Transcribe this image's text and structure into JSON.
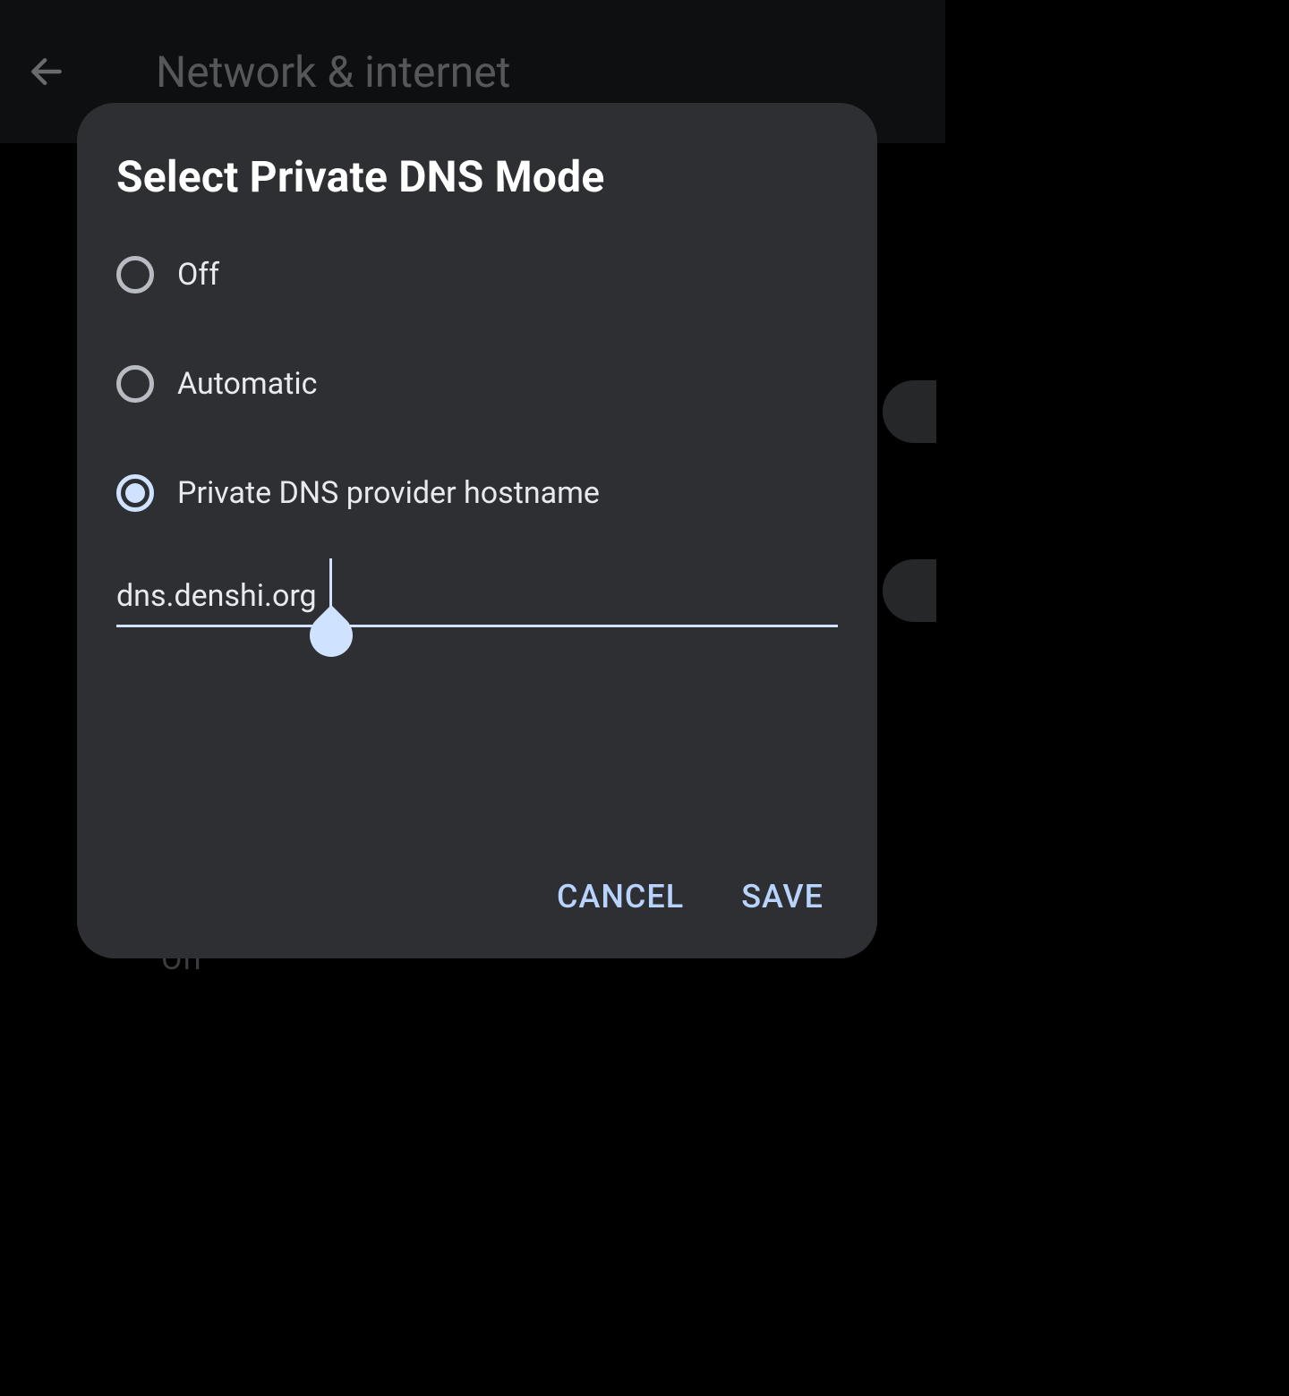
{
  "header": {
    "title": "Network & internet"
  },
  "background": {
    "off_label": "Off"
  },
  "dialog": {
    "title": "Select Private DNS Mode",
    "options": [
      {
        "label": "Off",
        "selected": false
      },
      {
        "label": "Automatic",
        "selected": false
      },
      {
        "label": "Private DNS provider hostname",
        "selected": true
      }
    ],
    "hostname_value": "dns.denshi.org",
    "actions": {
      "cancel": "CANCEL",
      "save": "SAVE"
    }
  },
  "colors": {
    "accent": "#cfe2ff",
    "dialog_bg": "#2d2f33",
    "page_bg": "#000000"
  }
}
